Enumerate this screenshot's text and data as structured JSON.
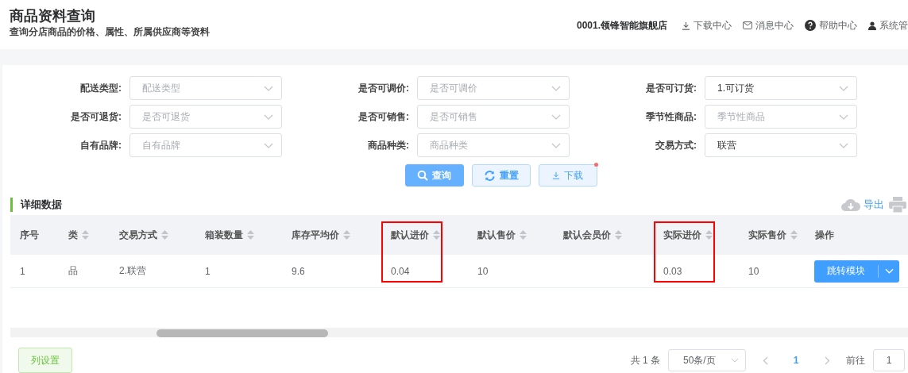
{
  "header": {
    "title": "商品资料查询",
    "subtitle": "查询分店商品的价格、属性、所属供应商等资料",
    "store": "0001.领锋智能旗舰店",
    "links": [
      {
        "kind": "download",
        "label": "下载中心"
      },
      {
        "kind": "mail",
        "label": "消息中心"
      },
      {
        "kind": "help",
        "label": "帮助中心"
      },
      {
        "kind": "user",
        "label": "系统管"
      }
    ]
  },
  "filters": [
    {
      "label": "配送类型:",
      "placeholder": "配送类型"
    },
    {
      "label": "是否可调价:",
      "placeholder": "是否可调价"
    },
    {
      "label": "是否可订货:",
      "value": "1.可订货"
    },
    {
      "label": "是否可退货:",
      "placeholder": "是否可退货"
    },
    {
      "label": "是否可销售:",
      "placeholder": "是否可销售"
    },
    {
      "label": "季节性商品:",
      "placeholder": "季节性商品"
    },
    {
      "label": "自有品牌:",
      "placeholder": "自有品牌"
    },
    {
      "label": "商品种类:",
      "placeholder": "商品种类"
    },
    {
      "label": "交易方式:",
      "value": "联营"
    }
  ],
  "actions": [
    {
      "kind": "search",
      "label": "查询"
    },
    {
      "kind": "reset",
      "label": "重置"
    },
    {
      "kind": "download",
      "label": "下载",
      "notify": true
    }
  ],
  "section": {
    "title": "详细数据",
    "tools": [
      {
        "kind": "export",
        "label": "导出"
      },
      {
        "kind": "print"
      }
    ]
  },
  "table": {
    "columns": [
      {
        "label": "序号",
        "sortable": false,
        "highlighted": false
      },
      {
        "label": "类",
        "sortable": true,
        "highlighted": false
      },
      {
        "label": "交易方式",
        "sortable": true,
        "highlighted": false
      },
      {
        "label": "箱装数量",
        "sortable": true,
        "highlighted": false
      },
      {
        "label": "库存平均价",
        "sortable": true,
        "highlighted": false
      },
      {
        "label": "默认进价",
        "sortable": true,
        "highlighted": true
      },
      {
        "label": "默认售价",
        "sortable": true,
        "highlighted": false
      },
      {
        "label": "默认会员价",
        "sortable": true,
        "highlighted": false
      },
      {
        "label": "实际进价",
        "sortable": true,
        "highlighted": true
      },
      {
        "label": "实际售价",
        "sortable": true,
        "highlighted": false
      },
      {
        "label": "操作",
        "sortable": false,
        "highlighted": false
      }
    ],
    "rows": [
      {
        "cells": [
          "1",
          "品",
          "2.联营",
          "1",
          "9.6",
          "0.04",
          "10",
          "",
          "0.03",
          "10"
        ],
        "action": "跳转模块"
      }
    ]
  },
  "footer": {
    "settings": "列设置",
    "total": "共 1 条",
    "page_size": "50条/页",
    "pages": [
      {
        "label": "1",
        "selected": true
      }
    ],
    "goto_label": "前往",
    "goto_value": "1"
  }
}
